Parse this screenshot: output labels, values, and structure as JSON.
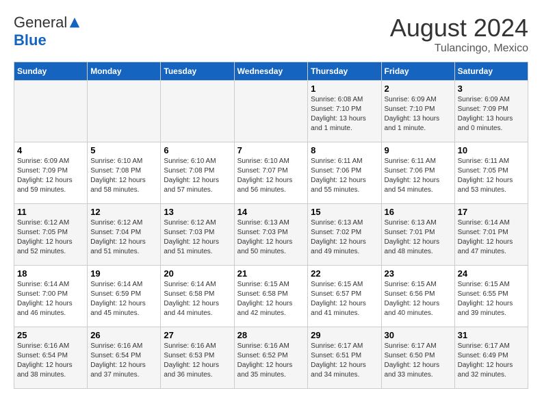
{
  "header": {
    "logo_general": "General",
    "logo_blue": "Blue",
    "month_year": "August 2024",
    "location": "Tulancingo, Mexico"
  },
  "weekdays": [
    "Sunday",
    "Monday",
    "Tuesday",
    "Wednesday",
    "Thursday",
    "Friday",
    "Saturday"
  ],
  "weeks": [
    [
      {
        "day": "",
        "info": ""
      },
      {
        "day": "",
        "info": ""
      },
      {
        "day": "",
        "info": ""
      },
      {
        "day": "",
        "info": ""
      },
      {
        "day": "1",
        "info": "Sunrise: 6:08 AM\nSunset: 7:10 PM\nDaylight: 13 hours\nand 1 minute."
      },
      {
        "day": "2",
        "info": "Sunrise: 6:09 AM\nSunset: 7:10 PM\nDaylight: 13 hours\nand 1 minute."
      },
      {
        "day": "3",
        "info": "Sunrise: 6:09 AM\nSunset: 7:09 PM\nDaylight: 13 hours\nand 0 minutes."
      }
    ],
    [
      {
        "day": "4",
        "info": "Sunrise: 6:09 AM\nSunset: 7:09 PM\nDaylight: 12 hours\nand 59 minutes."
      },
      {
        "day": "5",
        "info": "Sunrise: 6:10 AM\nSunset: 7:08 PM\nDaylight: 12 hours\nand 58 minutes."
      },
      {
        "day": "6",
        "info": "Sunrise: 6:10 AM\nSunset: 7:08 PM\nDaylight: 12 hours\nand 57 minutes."
      },
      {
        "day": "7",
        "info": "Sunrise: 6:10 AM\nSunset: 7:07 PM\nDaylight: 12 hours\nand 56 minutes."
      },
      {
        "day": "8",
        "info": "Sunrise: 6:11 AM\nSunset: 7:06 PM\nDaylight: 12 hours\nand 55 minutes."
      },
      {
        "day": "9",
        "info": "Sunrise: 6:11 AM\nSunset: 7:06 PM\nDaylight: 12 hours\nand 54 minutes."
      },
      {
        "day": "10",
        "info": "Sunrise: 6:11 AM\nSunset: 7:05 PM\nDaylight: 12 hours\nand 53 minutes."
      }
    ],
    [
      {
        "day": "11",
        "info": "Sunrise: 6:12 AM\nSunset: 7:05 PM\nDaylight: 12 hours\nand 52 minutes."
      },
      {
        "day": "12",
        "info": "Sunrise: 6:12 AM\nSunset: 7:04 PM\nDaylight: 12 hours\nand 51 minutes."
      },
      {
        "day": "13",
        "info": "Sunrise: 6:12 AM\nSunset: 7:03 PM\nDaylight: 12 hours\nand 51 minutes."
      },
      {
        "day": "14",
        "info": "Sunrise: 6:13 AM\nSunset: 7:03 PM\nDaylight: 12 hours\nand 50 minutes."
      },
      {
        "day": "15",
        "info": "Sunrise: 6:13 AM\nSunset: 7:02 PM\nDaylight: 12 hours\nand 49 minutes."
      },
      {
        "day": "16",
        "info": "Sunrise: 6:13 AM\nSunset: 7:01 PM\nDaylight: 12 hours\nand 48 minutes."
      },
      {
        "day": "17",
        "info": "Sunrise: 6:14 AM\nSunset: 7:01 PM\nDaylight: 12 hours\nand 47 minutes."
      }
    ],
    [
      {
        "day": "18",
        "info": "Sunrise: 6:14 AM\nSunset: 7:00 PM\nDaylight: 12 hours\nand 46 minutes."
      },
      {
        "day": "19",
        "info": "Sunrise: 6:14 AM\nSunset: 6:59 PM\nDaylight: 12 hours\nand 45 minutes."
      },
      {
        "day": "20",
        "info": "Sunrise: 6:14 AM\nSunset: 6:58 PM\nDaylight: 12 hours\nand 44 minutes."
      },
      {
        "day": "21",
        "info": "Sunrise: 6:15 AM\nSunset: 6:58 PM\nDaylight: 12 hours\nand 42 minutes."
      },
      {
        "day": "22",
        "info": "Sunrise: 6:15 AM\nSunset: 6:57 PM\nDaylight: 12 hours\nand 41 minutes."
      },
      {
        "day": "23",
        "info": "Sunrise: 6:15 AM\nSunset: 6:56 PM\nDaylight: 12 hours\nand 40 minutes."
      },
      {
        "day": "24",
        "info": "Sunrise: 6:15 AM\nSunset: 6:55 PM\nDaylight: 12 hours\nand 39 minutes."
      }
    ],
    [
      {
        "day": "25",
        "info": "Sunrise: 6:16 AM\nSunset: 6:54 PM\nDaylight: 12 hours\nand 38 minutes."
      },
      {
        "day": "26",
        "info": "Sunrise: 6:16 AM\nSunset: 6:54 PM\nDaylight: 12 hours\nand 37 minutes."
      },
      {
        "day": "27",
        "info": "Sunrise: 6:16 AM\nSunset: 6:53 PM\nDaylight: 12 hours\nand 36 minutes."
      },
      {
        "day": "28",
        "info": "Sunrise: 6:16 AM\nSunset: 6:52 PM\nDaylight: 12 hours\nand 35 minutes."
      },
      {
        "day": "29",
        "info": "Sunrise: 6:17 AM\nSunset: 6:51 PM\nDaylight: 12 hours\nand 34 minutes."
      },
      {
        "day": "30",
        "info": "Sunrise: 6:17 AM\nSunset: 6:50 PM\nDaylight: 12 hours\nand 33 minutes."
      },
      {
        "day": "31",
        "info": "Sunrise: 6:17 AM\nSunset: 6:49 PM\nDaylight: 12 hours\nand 32 minutes."
      }
    ]
  ]
}
